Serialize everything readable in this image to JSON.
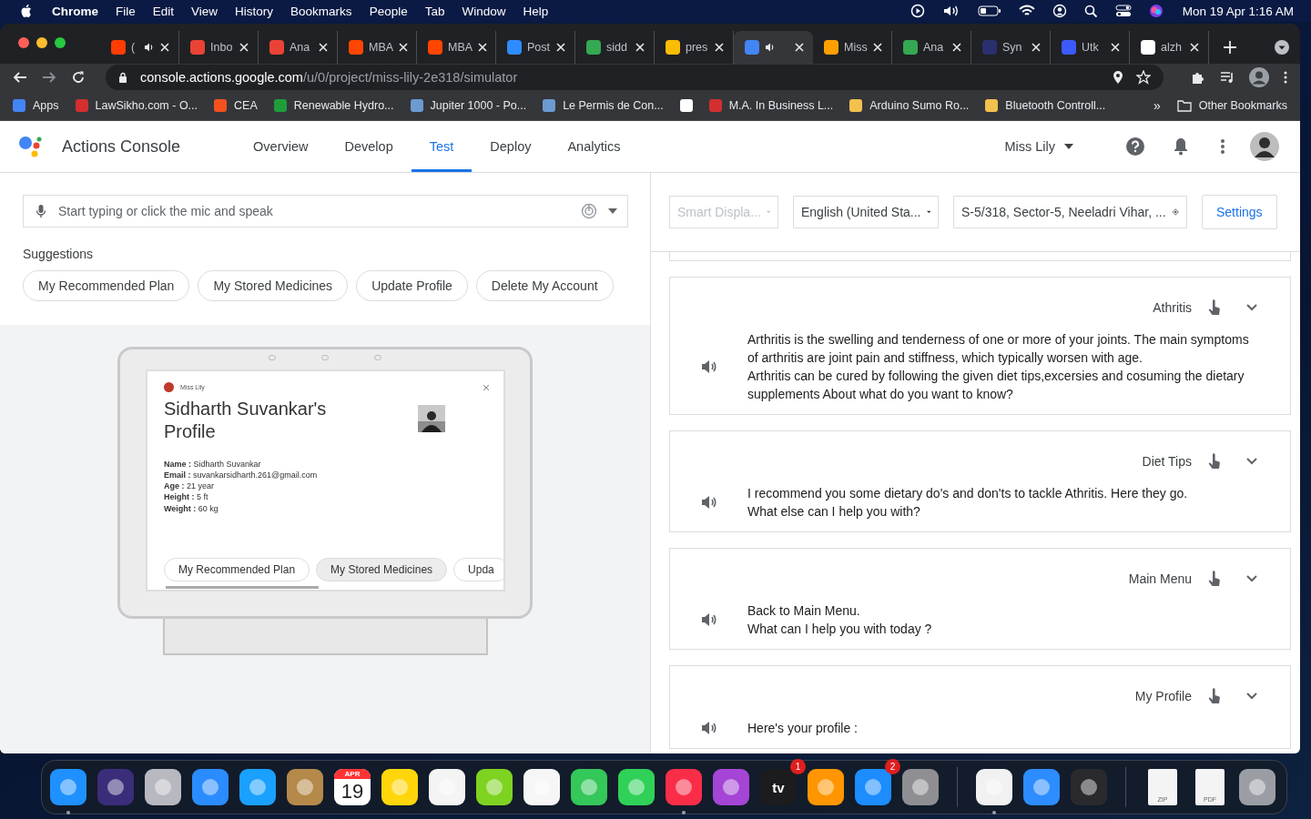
{
  "menu_bar": {
    "items": [
      "Chrome",
      "File",
      "Edit",
      "View",
      "History",
      "Bookmarks",
      "People",
      "Tab",
      "Window",
      "Help"
    ],
    "clock": "Mon 19 Apr  1:16 AM"
  },
  "tabs": [
    {
      "title": "(",
      "color": "#ff3d00",
      "audio": true,
      "selected": false
    },
    {
      "title": "Inbo",
      "color": "#ea4335",
      "audio": false,
      "selected": false
    },
    {
      "title": "Ana",
      "color": "#ea4335",
      "audio": false,
      "selected": false
    },
    {
      "title": "MBA",
      "color": "#ff4500",
      "audio": false,
      "selected": false
    },
    {
      "title": "MBA",
      "color": "#ff4500",
      "audio": false,
      "selected": false
    },
    {
      "title": "Post",
      "color": "#2d8cff",
      "audio": false,
      "selected": false
    },
    {
      "title": "sidd",
      "color": "#34a853",
      "audio": false,
      "selected": false
    },
    {
      "title": "pres",
      "color": "#fbbc04",
      "audio": false,
      "selected": false
    },
    {
      "color": "#4285f4",
      "audio": true,
      "selected": true
    },
    {
      "title": "Miss",
      "color": "#ffa000",
      "audio": false,
      "selected": false
    },
    {
      "title": "Ana",
      "color": "#34a853",
      "audio": false,
      "selected": false
    },
    {
      "title": "Syn",
      "color": "#2a2f6e",
      "audio": false,
      "selected": false
    },
    {
      "title": "Utk",
      "color": "#3d5afe",
      "audio": false,
      "selected": false
    },
    {
      "title": "alzh",
      "color": "#ffffff",
      "audio": false,
      "selected": false
    }
  ],
  "address": {
    "host": "console.actions.google.com",
    "path": "/u/0/project/miss-lily-2e318/simulator"
  },
  "bookmarks": [
    {
      "label": "Apps",
      "color": "#4285f4"
    },
    {
      "label": "LawSikho.com - O...",
      "color": "#d32f2f"
    },
    {
      "label": "CEA",
      "color": "#f4511e"
    },
    {
      "label": "Renewable Hydro...",
      "color": "#1e9e3a"
    },
    {
      "label": "Jupiter 1000 - Po...",
      "color": "#6b9bd2"
    },
    {
      "label": "Le Permis de Con...",
      "color": "#6b9bd2"
    },
    {
      "color": "#ffffff"
    },
    {
      "label": "M.A. In Business L...",
      "color": "#d32f2f"
    },
    {
      "label": "Arduino Sumo Ro...",
      "color": "#f2c14e"
    },
    {
      "label": "Bluetooth Controll...",
      "color": "#f2c14e"
    }
  ],
  "bookmarks_more": "»",
  "other_bookmarks": "Other Bookmarks",
  "app": {
    "title": "Actions Console",
    "nav": [
      {
        "label": "Overview",
        "selected": false
      },
      {
        "label": "Develop",
        "selected": false
      },
      {
        "label": "Test",
        "selected": true
      },
      {
        "label": "Deploy",
        "selected": false
      },
      {
        "label": "Analytics",
        "selected": false
      }
    ],
    "project": "Miss Lily"
  },
  "simulator": {
    "input": {
      "placeholder": "Start typing or click the mic and speak"
    },
    "suggestions_label": "Suggestions",
    "suggestions": [
      "My Recommended Plan",
      "My Stored Medicines",
      "Update Profile",
      "Delete My Account"
    ],
    "device": {
      "assistant": "Miss Lily",
      "title": "Sidharth Suvankar's Profile",
      "fields": [
        "**Name :** Sidharth Suvankar",
        "**Email :** suvankarsidharth.261@gmail.com",
        "**Age :** 21 year",
        "**Height :** 5 ft",
        "**Weight :** 60 kg"
      ],
      "chips": [
        {
          "label": "My Recommended Plan",
          "selected": false
        },
        {
          "label": "My Stored Medicines",
          "selected": true
        },
        {
          "label": "Upda",
          "selected": false
        }
      ]
    }
  },
  "output": {
    "surface": {
      "value": "Smart Displa...",
      "disabled": true
    },
    "language": "English (United Sta...",
    "location": "S-5/318, Sector-5, Neeladri Vihar, ...",
    "settings": "Settings",
    "responses": [
      {
        "intent": "Athritis",
        "lines": [
          "Arthritis is the swelling and tenderness of one or more of your joints. The main symptoms of arthritis are joint pain and stiffness, which typically worsen with age.",
          "Arthritis can be cured by following the given diet tips,excersies and cosuming the dietary supplements About what do you want to know?"
        ]
      },
      {
        "intent": "Diet Tips",
        "lines": [
          "I recommend you some dietary do's and don'ts to tackle Athritis. Here they go.",
          "What else can I help you with?"
        ]
      },
      {
        "intent": "Main Menu",
        "lines": [
          "Back to Main Menu.",
          "What can I help you with today ?"
        ]
      },
      {
        "intent": "My Profile",
        "lines": [
          "Here's your profile :"
        ]
      }
    ]
  },
  "dock": [
    {
      "kind": "app",
      "color": "#1e90ff",
      "running": true
    },
    {
      "kind": "app",
      "color": "#3a2d7a"
    },
    {
      "kind": "app",
      "color": "#b8b8c0"
    },
    {
      "kind": "app",
      "color": "#2b8cff"
    },
    {
      "kind": "app",
      "color": "#1aa0ff"
    },
    {
      "kind": "app",
      "color": "#b5894a"
    },
    {
      "kind": "calendar",
      "month": "APR",
      "day": "19",
      "color": "#ffffff"
    },
    {
      "kind": "app",
      "color": "#ffd60a"
    },
    {
      "kind": "app",
      "color": "#f4f4f4"
    },
    {
      "kind": "app",
      "color": "#7ed321"
    },
    {
      "kind": "app",
      "color": "#f6f6f6"
    },
    {
      "kind": "app",
      "color": "#34c759"
    },
    {
      "kind": "app",
      "color": "#30d158"
    },
    {
      "kind": "app",
      "color": "#fa2d48",
      "running": true
    },
    {
      "kind": "app",
      "color": "#a445d6"
    },
    {
      "kind": "tv",
      "label": "tv",
      "badge": "1",
      "color": "#1c1c1e"
    },
    {
      "kind": "app",
      "color": "#ff9500"
    },
    {
      "kind": "app",
      "badge": "2",
      "color": "#1c8cff"
    },
    {
      "kind": "app",
      "color": "#8e8e93"
    },
    {
      "kind": "separator"
    },
    {
      "kind": "app",
      "color": "#f1f1f1",
      "running": true
    },
    {
      "kind": "app",
      "color": "#2d8cff"
    },
    {
      "kind": "app",
      "color": "#2a2a2e"
    },
    {
      "kind": "separator"
    },
    {
      "kind": "doc",
      "label": "ZIP",
      "color": "#f4f4f4"
    },
    {
      "kind": "doc",
      "label": "PDF",
      "color": "#f4f4f4"
    },
    {
      "kind": "app",
      "color": "#9a9ea4"
    }
  ]
}
